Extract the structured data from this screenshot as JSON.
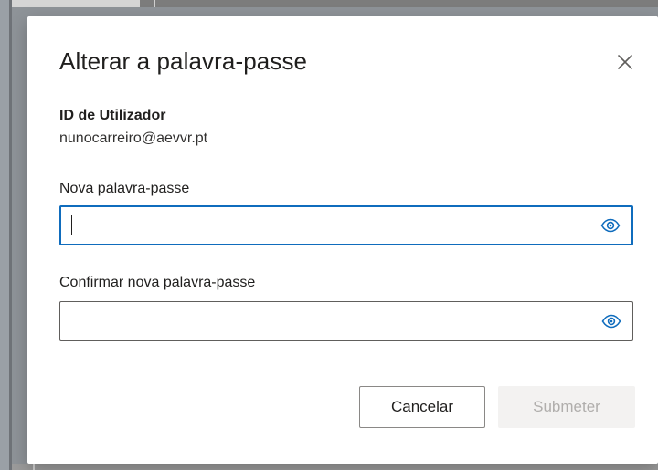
{
  "dialog": {
    "title": "Alterar a palavra-passe",
    "close_icon": "close-icon"
  },
  "user": {
    "id_label": "ID de Utilizador",
    "id_value": "nunocarreiro@aevvr.pt"
  },
  "new_password": {
    "label": "Nova palavra-passe",
    "value": "",
    "icon": "eye-icon",
    "focused": true
  },
  "confirm_password": {
    "label": "Confirmar nova palavra-passe",
    "value": "",
    "icon": "eye-icon"
  },
  "buttons": {
    "cancel_label": "Cancelar",
    "submit_label": "Submeter",
    "submit_disabled": true
  },
  "colors": {
    "accent": "#0f6cbd",
    "eye_icon": "#0f6cbd",
    "disabled_text": "#b0aeac",
    "disabled_bg": "#f3f2f1"
  }
}
